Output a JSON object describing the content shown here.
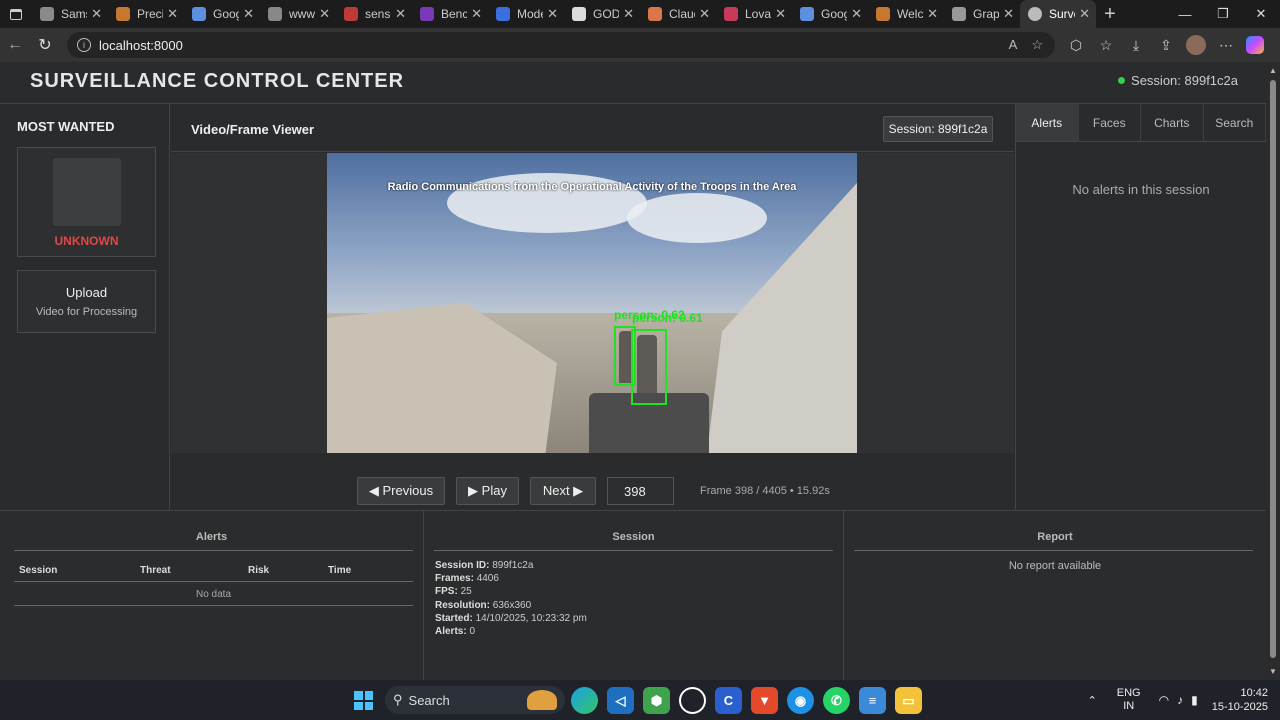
{
  "browser": {
    "tabs": [
      {
        "label": "Samsu",
        "color": "#8a8a8a"
      },
      {
        "label": "Precis",
        "color": "#c8782e"
      },
      {
        "label": "Goog",
        "color": "#5b8fe0"
      },
      {
        "label": "www.",
        "color": "#888888"
      },
      {
        "label": "senso",
        "color": "#c03a3a"
      },
      {
        "label": "Bench",
        "color": "#7a3ab8"
      },
      {
        "label": "Mode",
        "color": "#3a6fe0"
      },
      {
        "label": "GOD",
        "color": "#dddddd"
      },
      {
        "label": "Claud",
        "color": "#d9774a"
      },
      {
        "label": "Lovab",
        "color": "#c83a5a"
      },
      {
        "label": "Goog",
        "color": "#5b8fe0"
      },
      {
        "label": "Welco",
        "color": "#c8782e"
      },
      {
        "label": "Graph",
        "color": "#999999"
      },
      {
        "label": "Surve",
        "color": "#bbbbbb"
      }
    ],
    "url": "localhost:8000"
  },
  "header": {
    "title": "SURVEILLANCE CONTROL CENTER",
    "session": "Session: 899f1c2a"
  },
  "left": {
    "most_wanted_title": "MOST WANTED",
    "unknown_label": "UNKNOWN",
    "upload_title": "Upload",
    "upload_sub": "Video for Processing"
  },
  "viewer": {
    "title": "Video/Frame Viewer",
    "session_badge": "Session: 899f1c2a",
    "caption": "Radio Communications from the Operational Activity of the Troops in the Area",
    "detections": [
      {
        "label": "person: 0.62"
      },
      {
        "label": "person: 0.61"
      }
    ],
    "prev_label": "◀ Previous",
    "play_label": "▶ Play",
    "next_label": "Next ▶",
    "frame_value": "398",
    "frame_info": "Frame 398 / 4405 • 15.92s"
  },
  "right": {
    "tabs": [
      "Alerts",
      "Faces",
      "Charts",
      "Search"
    ],
    "active_tab": "Alerts",
    "empty_text": "No alerts in this session"
  },
  "bottom": {
    "alerts": {
      "title": "Alerts",
      "columns": [
        "Session",
        "Threat",
        "Risk",
        "Time"
      ],
      "empty": "No data"
    },
    "session": {
      "title": "Session",
      "id_label": "Session ID:",
      "id_value": "899f1c2a",
      "frames_label": "Frames:",
      "frames_value": "4406",
      "fps_label": "FPS:",
      "fps_value": "25",
      "res_label": "Resolution:",
      "res_value": "636x360",
      "started_label": "Started:",
      "started_value": "14/10/2025, 10:23:32 pm",
      "alerts_label": "Alerts:",
      "alerts_value": "0"
    },
    "report": {
      "title": "Report",
      "empty": "No report available"
    }
  },
  "taskbar": {
    "search": "Search",
    "lang_line1": "ENG",
    "lang_line2": "IN",
    "time": "10:42",
    "date": "15-10-2025"
  },
  "colors": {
    "status_dot": "#33d04b",
    "unknown": "#e04848",
    "detection": "#22e022"
  }
}
